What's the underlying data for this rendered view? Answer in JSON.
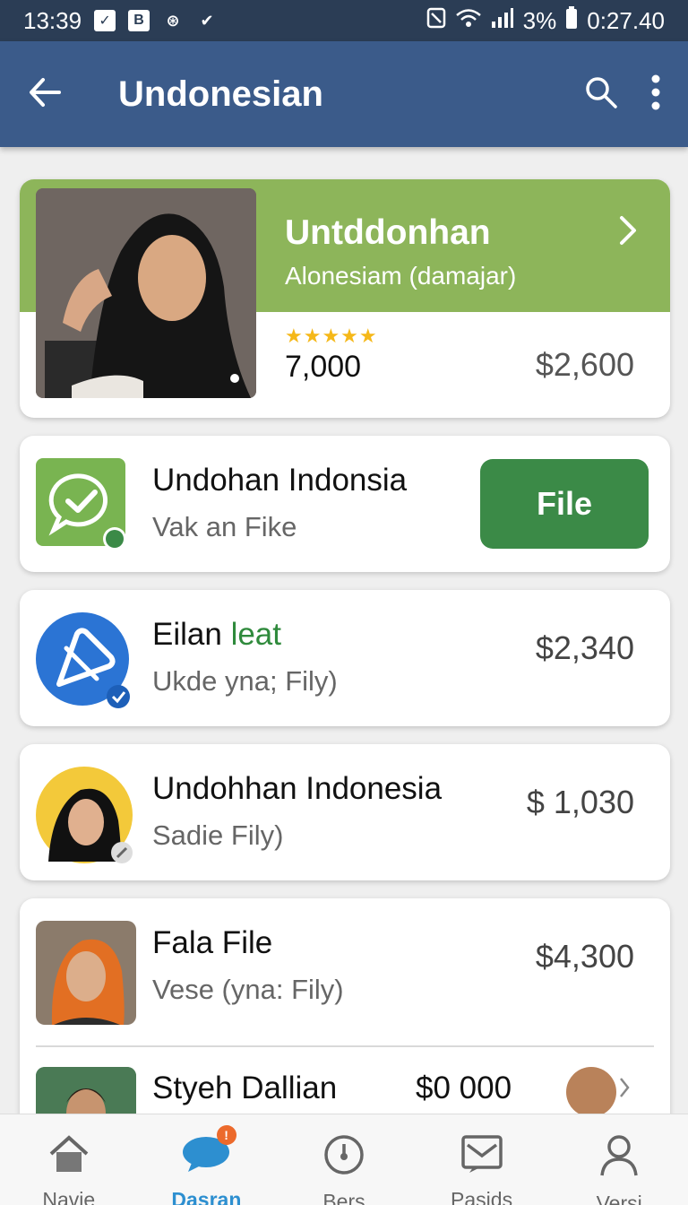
{
  "status_bar": {
    "time": "13:39",
    "left_icons": [
      "sim-icon",
      "b-icon",
      "cycle-icon",
      "check-icon"
    ],
    "battery": "3%",
    "clock_right": "0:27.40"
  },
  "app_bar": {
    "title": "Undonesian",
    "back_icon": "arrow-left-icon",
    "search_icon": "search-icon",
    "menu_icon": "more-vert-icon"
  },
  "featured": {
    "title": "Untddonhan",
    "subtitle": "Alonesiam (damajar)",
    "rating_stars": 5,
    "count": "7,000",
    "price": "$2,600"
  },
  "rows": [
    {
      "title": "Undohan Indonsia",
      "subtitle": "Vak an Fike",
      "button": "File"
    },
    {
      "title": "Eilan",
      "title_accent": "leat",
      "subtitle": "Ukde  yna; Fily)",
      "price": "$2,340"
    },
    {
      "title": "Undohhan Indonesia",
      "subtitle": "Sadie Fily)",
      "price": "$ 1,030"
    },
    {
      "title": "Fala File",
      "subtitle": "Vese (yna: Fily)",
      "price": "$4,300"
    },
    {
      "title": "Styeh Dallian",
      "price": "$0 000"
    }
  ],
  "bottom_nav": [
    {
      "label": "Navie",
      "icon": "home-icon"
    },
    {
      "label": "Dasran",
      "icon": "chat-icon",
      "badge": "!"
    },
    {
      "label": "Bers",
      "icon": "clock-icon"
    },
    {
      "label": "Pasids",
      "icon": "inbox-icon"
    },
    {
      "label": "Versi",
      "icon": "person-icon"
    }
  ],
  "colors": {
    "status_bar": "#2b3d55",
    "app_bar": "#3b5b8a",
    "featured_band": "#8db55a",
    "file_button": "#3b8a47",
    "nav_active": "#2d8fd0"
  }
}
